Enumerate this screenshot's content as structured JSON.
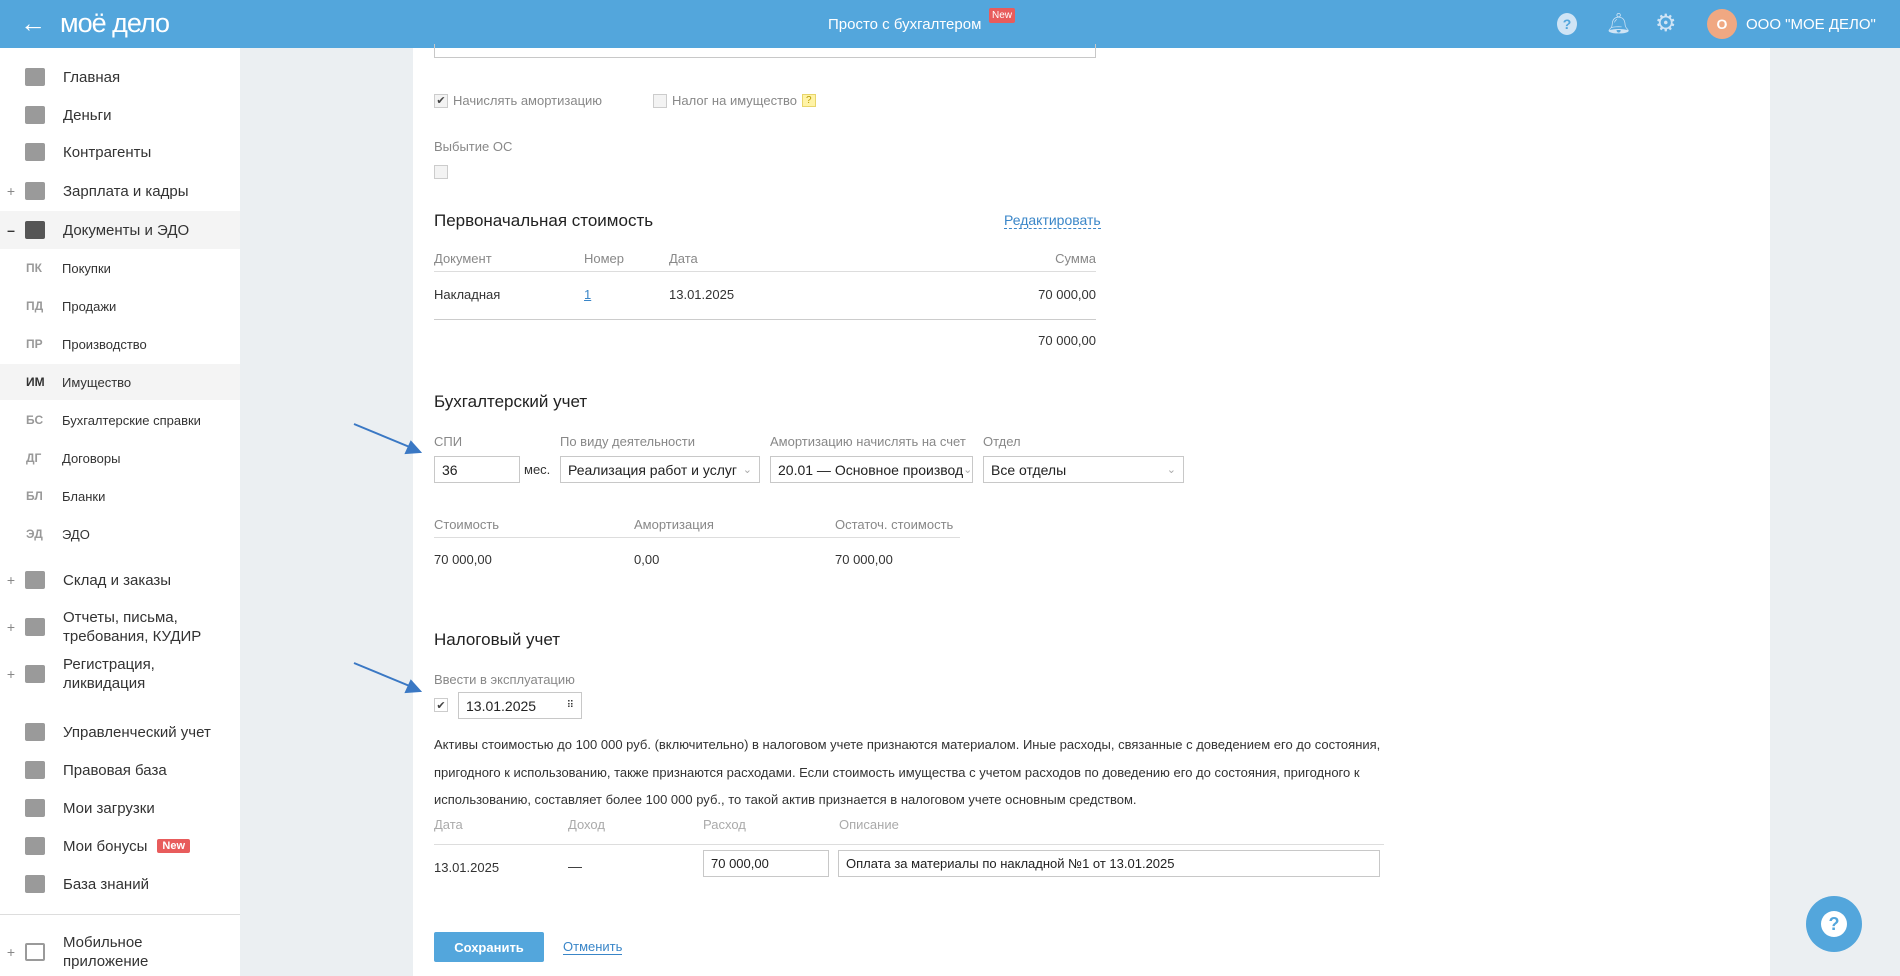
{
  "header": {
    "logo": "моё дело",
    "center_title": "Просто с бухгалтером",
    "new_badge": "New",
    "avatar_letter": "О",
    "company": "ООО \"МОЕ ДЕЛО\""
  },
  "sidebar": {
    "items": [
      {
        "label": "Главная",
        "icon": "home-icon",
        "plus": ""
      },
      {
        "label": "Деньги",
        "icon": "money-icon",
        "plus": ""
      },
      {
        "label": "Контрагенты",
        "icon": "contractor-icon",
        "plus": ""
      },
      {
        "label": "Зарплата и кадры",
        "icon": "salary-icon",
        "plus": "+"
      },
      {
        "label": "Документы и ЭДО",
        "icon": "folder-icon",
        "plus": "–"
      }
    ],
    "sub": [
      {
        "abbr": "ПК",
        "label": "Покупки"
      },
      {
        "abbr": "ПД",
        "label": "Продажи"
      },
      {
        "abbr": "ПР",
        "label": "Производство"
      },
      {
        "abbr": "ИМ",
        "label": "Имущество"
      },
      {
        "abbr": "БС",
        "label": "Бухгалтерские справки"
      },
      {
        "abbr": "ДГ",
        "label": "Договоры"
      },
      {
        "abbr": "БЛ",
        "label": "Бланки"
      },
      {
        "abbr": "ЭД",
        "label": "ЭДО"
      }
    ],
    "items2": [
      {
        "label": "Склад и заказы",
        "plus": "+"
      },
      {
        "label": "Отчеты, письма, требования, КУДИР",
        "plus": "+"
      },
      {
        "label": "Регистрация, ликвидация",
        "plus": "+"
      },
      {
        "label": "Управленческий учет",
        "plus": ""
      },
      {
        "label": "Правовая база",
        "plus": ""
      },
      {
        "label": "Мои загрузки",
        "plus": ""
      },
      {
        "label": "Мои бонусы",
        "plus": "",
        "badge": "New"
      },
      {
        "label": "База знаний",
        "plus": ""
      }
    ],
    "mobile": {
      "label": "Мобильное приложение",
      "plus": "+"
    }
  },
  "form": {
    "depreciation_label": "Начислять амортизацию",
    "property_tax_label": "Налог на имущество",
    "help_mark": "?",
    "disposal_label": "Выбытие ОС",
    "initial_cost": {
      "title": "Первоначальная стоимость",
      "edit": "Редактировать",
      "headers": [
        "Документ",
        "Номер",
        "Дата",
        "Сумма"
      ],
      "row": [
        "Накладная",
        "1",
        "13.01.2025",
        "70 000,00"
      ],
      "total": "70 000,00"
    },
    "accounting": {
      "title": "Бухгалтерский учет",
      "spi_label": "СПИ",
      "spi_value": "36",
      "spi_unit": "мес.",
      "activity_label": "По виду деятельности",
      "activity_value": "Реализация работ и услуг",
      "account_label": "Амортизацию начислять на счет",
      "account_value": "20.01 — Основное производ",
      "dept_label": "Отдел",
      "dept_value": "Все отделы",
      "headers": [
        "Стоимость",
        "Амортизация",
        "Остаточ. стоимость"
      ],
      "values": [
        "70 000,00",
        "0,00",
        "70 000,00"
      ]
    },
    "tax": {
      "title": "Налоговый учет",
      "commission_label": "Ввести в эксплуатацию",
      "commission_date": "13.01.2025",
      "notice": [
        "Активы стоимостью до 100 000 руб. (включительно) в налоговом учете признаются материалом. Иные расходы, связанные с доведением его до состояния,",
        "пригодного к использованию, также признаются расходами. Если стоимость имущества с учетом расходов по доведению его до состояния, пригодного к",
        "использованию, составляет более 100 000 руб., то такой актив признается в налоговом учете основным средством."
      ],
      "headers": [
        "Дата",
        "Доход",
        "Расход",
        "Описание"
      ],
      "row": {
        "date": "13.01.2025",
        "income": "—",
        "expense": "70 000,00",
        "description": "Оплата за материалы по накладной №1 от 13.01.2025"
      }
    },
    "save": "Сохранить",
    "cancel": "Отменить"
  },
  "colors": {
    "brand": "#53a6dc",
    "badge": "#e85c5c",
    "avatar": "#f0a882"
  }
}
